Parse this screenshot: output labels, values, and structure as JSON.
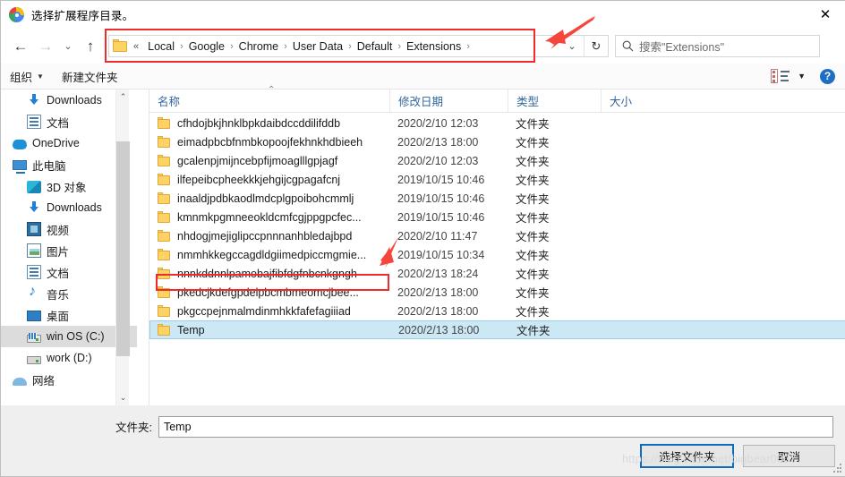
{
  "window": {
    "title": "选择扩展程序目录。",
    "app_icon": "chrome-logo-icon",
    "close_label": "✕"
  },
  "nav": {
    "back_icon": "←",
    "forward_icon": "→",
    "recent_icon": "⌄",
    "up_icon": "↑",
    "folder_icon": "folder-icon",
    "breadcrumb_overflow": "«",
    "breadcrumbs": [
      {
        "label": "Local"
      },
      {
        "label": "Google"
      },
      {
        "label": "Chrome"
      },
      {
        "label": "User Data"
      },
      {
        "label": "Default"
      },
      {
        "label": "Extensions"
      }
    ],
    "separator": "›",
    "dropdown_icon": "⌄",
    "refresh_icon": "↻"
  },
  "search": {
    "icon": "search-icon",
    "placeholder": "搜索\"Extensions\""
  },
  "toolbar": {
    "organize_label": "组织",
    "organize_caret": "▼",
    "new_folder_label": "新建文件夹",
    "view_icon": "view-layout-icon",
    "view_caret": "▼",
    "help_icon": "?"
  },
  "sidebar": {
    "items": [
      {
        "label": "Downloads",
        "icon": "download-icon",
        "pinned": true,
        "indent": 1,
        "selected": false
      },
      {
        "label": "文档",
        "icon": "document-icon",
        "pinned": true,
        "indent": 1,
        "selected": false
      },
      {
        "label": "OneDrive",
        "icon": "onedrive-icon",
        "pinned": false,
        "indent": 0,
        "selected": false
      },
      {
        "label": "此电脑",
        "icon": "this-pc-icon",
        "pinned": false,
        "indent": 0,
        "selected": false
      },
      {
        "label": "3D 对象",
        "icon": "3d-objects-icon",
        "pinned": false,
        "indent": 1,
        "selected": false
      },
      {
        "label": "Downloads",
        "icon": "download-icon",
        "pinned": false,
        "indent": 1,
        "selected": false
      },
      {
        "label": "视频",
        "icon": "videos-icon",
        "pinned": false,
        "indent": 1,
        "selected": false
      },
      {
        "label": "图片",
        "icon": "pictures-icon",
        "pinned": false,
        "indent": 1,
        "selected": false
      },
      {
        "label": "文档",
        "icon": "document-icon",
        "pinned": false,
        "indent": 1,
        "selected": false
      },
      {
        "label": "音乐",
        "icon": "music-icon",
        "pinned": false,
        "indent": 1,
        "selected": false
      },
      {
        "label": "桌面",
        "icon": "desktop-icon",
        "pinned": false,
        "indent": 1,
        "selected": false
      },
      {
        "label": "win OS (C:)",
        "icon": "system-drive-icon",
        "pinned": false,
        "indent": 1,
        "selected": true
      },
      {
        "label": "work (D:)",
        "icon": "drive-icon",
        "pinned": false,
        "indent": 1,
        "selected": false
      },
      {
        "label": "网络",
        "icon": "network-icon",
        "pinned": false,
        "indent": 0,
        "selected": false
      }
    ],
    "scroll_up_icon": "⌃",
    "scroll_down_icon": "⌄"
  },
  "filelist": {
    "columns": [
      {
        "key": "name",
        "label": "名称"
      },
      {
        "key": "date",
        "label": "修改日期"
      },
      {
        "key": "type",
        "label": "类型"
      },
      {
        "key": "size",
        "label": "大小"
      }
    ],
    "sort_indicator": "⌃",
    "rows": [
      {
        "name": "cfhdojbkjhnklbpkdaibdccddilifddb",
        "date": "2020/2/10 12:03",
        "type": "文件夹",
        "size": "",
        "selected": false,
        "highlighted": false
      },
      {
        "name": "eimadpbcbfnmbkopoojfekhnkhdbieeh",
        "date": "2020/2/13 18:00",
        "type": "文件夹",
        "size": "",
        "selected": false,
        "highlighted": false
      },
      {
        "name": "gcalenpjmijncebpfijmoaglllgpjagf",
        "date": "2020/2/10 12:03",
        "type": "文件夹",
        "size": "",
        "selected": false,
        "highlighted": false
      },
      {
        "name": "ilfepeibcpheekkkjehgijcgpagafcnj",
        "date": "2019/10/15 10:46",
        "type": "文件夹",
        "size": "",
        "selected": false,
        "highlighted": false
      },
      {
        "name": "inaaldjpdbkaodlmdcplgpoibohcmmlj",
        "date": "2019/10/15 10:46",
        "type": "文件夹",
        "size": "",
        "selected": false,
        "highlighted": false
      },
      {
        "name": "kmnmkpgmneeokldcmfcgjppgpcfec...",
        "date": "2019/10/15 10:46",
        "type": "文件夹",
        "size": "",
        "selected": false,
        "highlighted": false
      },
      {
        "name": "nhdogjmejiglipccpnnnanhbledajbpd",
        "date": "2020/2/10 11:47",
        "type": "文件夹",
        "size": "",
        "selected": false,
        "highlighted": false
      },
      {
        "name": "nmmhkkegccagdldgiimedpiccmgmie...",
        "date": "2019/10/15 10:34",
        "type": "文件夹",
        "size": "",
        "selected": false,
        "highlighted": false
      },
      {
        "name": "nnnkddnnlpamobajfibfdgfnbcnkgngh",
        "date": "2020/2/13 18:24",
        "type": "文件夹",
        "size": "",
        "selected": false,
        "highlighted": true
      },
      {
        "name": "pkedcjkdefgpdelpbcmbmeomcjbee...",
        "date": "2020/2/13 18:00",
        "type": "文件夹",
        "size": "",
        "selected": false,
        "highlighted": false
      },
      {
        "name": "pkgccpejnmalmdinmhkkfafefagiiiad",
        "date": "2020/2/13 18:00",
        "type": "文件夹",
        "size": "",
        "selected": false,
        "highlighted": false
      },
      {
        "name": "Temp",
        "date": "2020/2/13 18:00",
        "type": "文件夹",
        "size": "",
        "selected": true,
        "highlighted": false
      }
    ]
  },
  "footer": {
    "folder_label": "文件夹:",
    "folder_value": "Temp",
    "select_button": "选择文件夹",
    "cancel_button": "取消"
  },
  "watermark": "https://blog.csdn.net/bigbear0007",
  "colors": {
    "accent": "#0f6cbd",
    "annotation_red": "#f02b2b",
    "selection_blue": "#cce8f4",
    "column_header": "#33669e"
  }
}
